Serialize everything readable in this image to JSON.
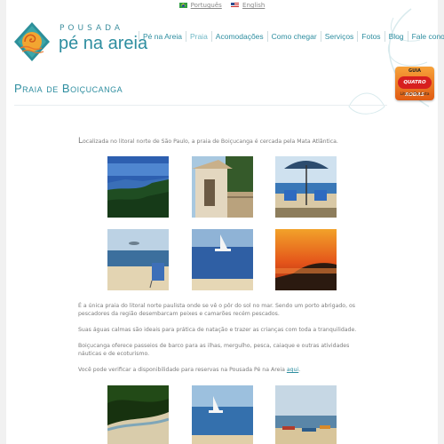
{
  "languages": [
    {
      "label": "Português",
      "flag": "brazil-flag-icon"
    },
    {
      "label": "English",
      "flag": "usa-flag-icon"
    }
  ],
  "logo": {
    "small_text": "POUSADA",
    "big_text": "pé na areia"
  },
  "nav": {
    "items": [
      {
        "label": "Pé na Areia",
        "active": false
      },
      {
        "label": "Praia",
        "active": true
      },
      {
        "label": "Acomodações",
        "active": false
      },
      {
        "label": "Como chegar",
        "active": false
      },
      {
        "label": "Serviços",
        "active": false
      },
      {
        "label": "Fotos",
        "active": false
      },
      {
        "label": "Blog",
        "active": false
      },
      {
        "label": "Fale conosco",
        "active": false
      }
    ]
  },
  "guide_badge": {
    "top": "GUIA",
    "middle": "QUATRO RODAS",
    "bottom": "Litoral Paulista"
  },
  "page_title": "Praia de Boiçucanga",
  "content": {
    "intro": "Localizada no litoral norte de São Paulo, a praia de Boiçucanga é cercada pela Mata Atlântica.",
    "p1": "É a única praia do litoral norte paulista onde se vê o pôr do sol no mar. Sendo um porto abrigado, os pescadores da região desembarcam peixes e camarões recém pescados.",
    "p2": "Suas águas calmas são ideais para prática de natação e trazer as crianças com toda a tranquilidade.",
    "p3": "Boiçucanga oferece passeios de barco para as ilhas, mergulho, pesca, caiaque e outras atividades náuticas e de ecoturismo.",
    "p4_prefix": "Você pode verificar a disponibilidade para reservas na Pousada Pé na Areia ",
    "p4_link": "aqui",
    "p4_suffix": "."
  },
  "colors": {
    "accent": "#2e8ea0",
    "text": "#7b7b7b",
    "active_nav": "#6fb8c6"
  }
}
